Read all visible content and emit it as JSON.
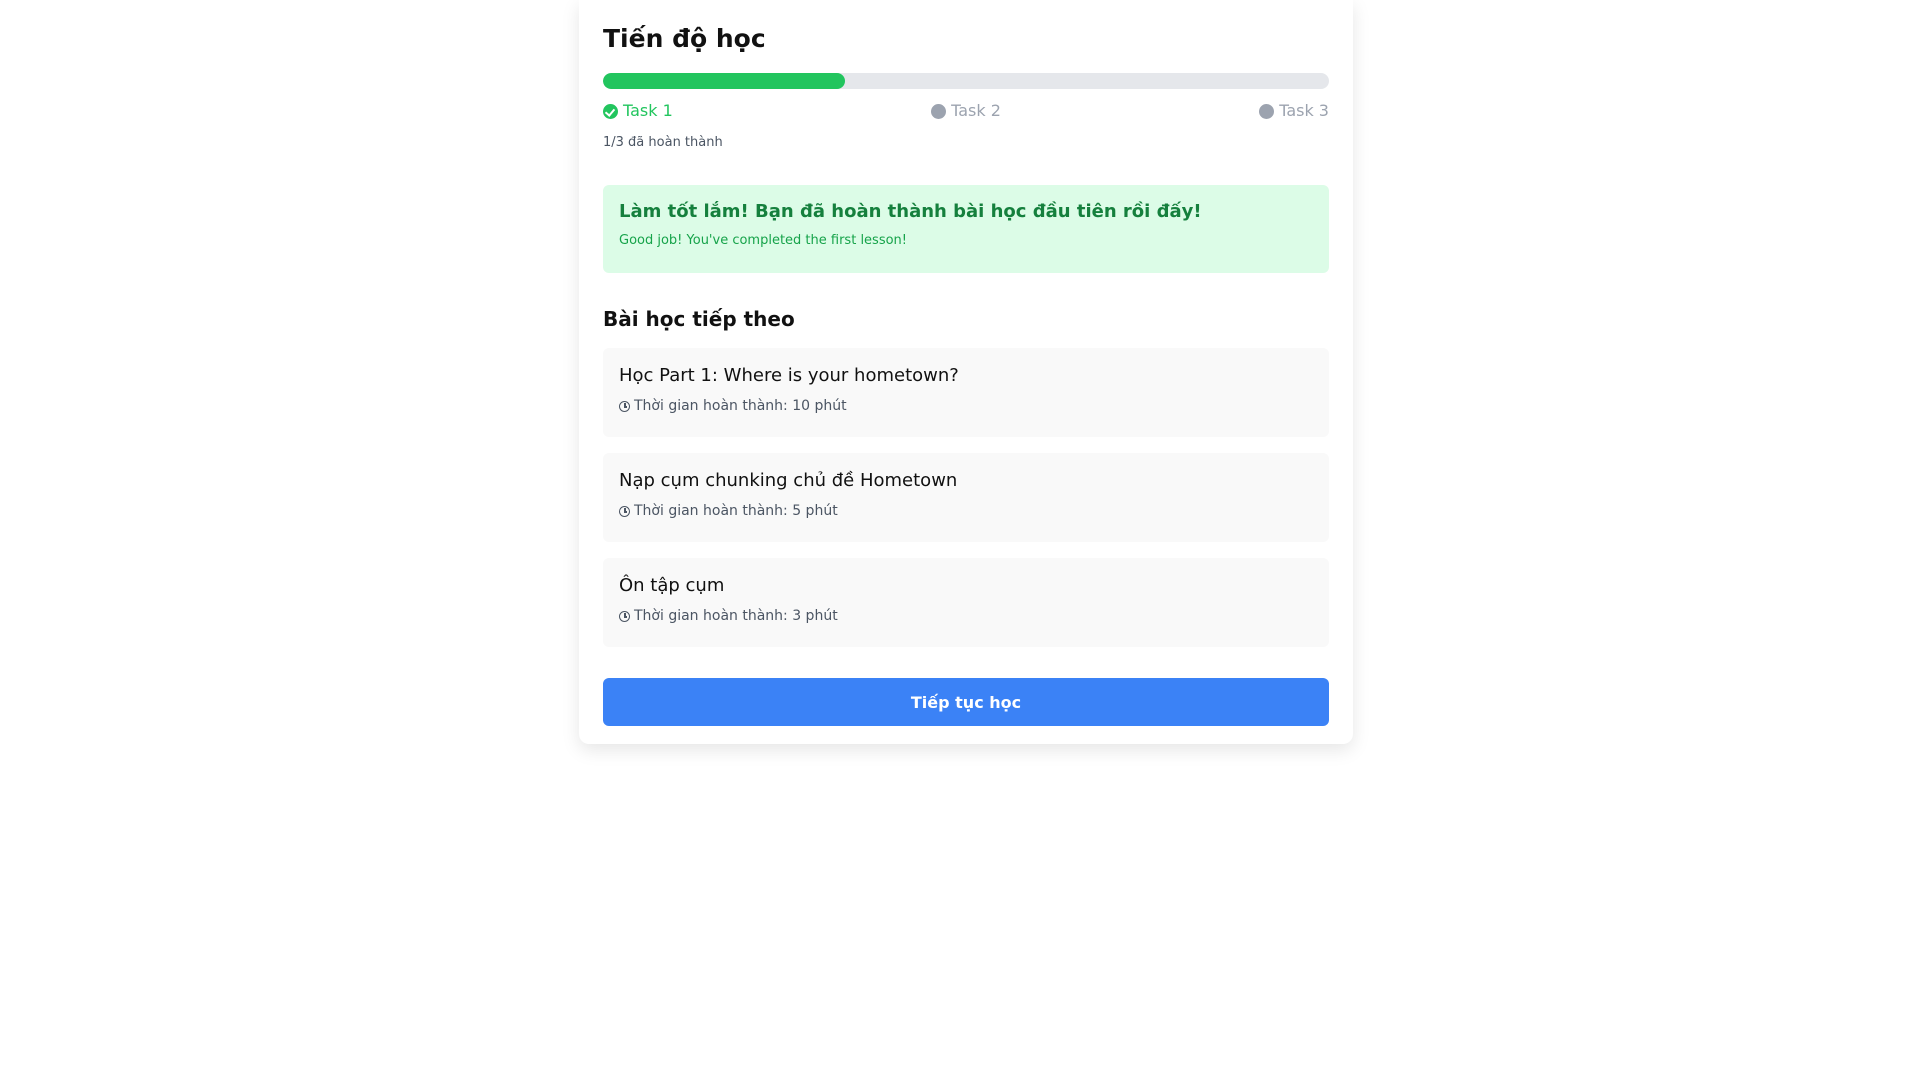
{
  "header": {
    "title": "Tiến độ học"
  },
  "progress": {
    "completed": 1,
    "total": 3,
    "fraction": 0.333,
    "text": "1/3 đã hoàn thành",
    "steps": [
      {
        "label": "Task 1",
        "status": "done"
      },
      {
        "label": "Task 2",
        "status": "pending"
      },
      {
        "label": "Task 3",
        "status": "pending"
      }
    ]
  },
  "alert": {
    "title": "Làm tốt lắm! Bạn đã hoàn thành bài học đầu tiên rồi đấy!",
    "subtitle": "Good job! You've completed the first lesson!"
  },
  "next_lessons": {
    "heading": "Bài học tiếp theo",
    "items": [
      {
        "title": "Học Part 1: Where is your hometown?",
        "duration": "Thời gian hoàn thành: 10 phút"
      },
      {
        "title": "Nạp cụm chunking chủ đề Hometown",
        "duration": "Thời gian hoàn thành: 5 phút"
      },
      {
        "title": "Ôn tập cụm",
        "duration": "Thời gian hoàn thành: 3 phút"
      }
    ]
  },
  "cta": {
    "label": "Tiếp tục học"
  },
  "colors": {
    "accent": "#3b82f6",
    "success": "#22c55e",
    "success_bg": "#dcfce7",
    "pending": "#9ca3af"
  },
  "icons": {
    "step_done": "check-circle-icon",
    "step_pending": "circle-icon",
    "duration": "clock-icon"
  }
}
